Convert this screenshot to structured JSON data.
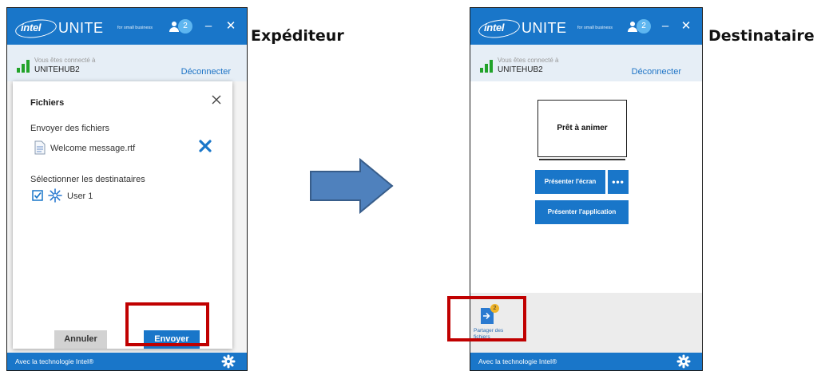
{
  "labels": {
    "sender": "Expéditeur",
    "recipient": "Destinataire"
  },
  "app": {
    "logo_intel": "intel",
    "logo_unite": "UNITE",
    "logo_sub": "for small business",
    "users_count": "2",
    "connected_label": "Vous êtes connecté à",
    "hub_name": "UNITEHUB2",
    "disconnect": "Déconnecter",
    "footer": "Avec la technologie Intel®",
    "brand_color": "#1976c9",
    "signal_color": "#22a32a"
  },
  "sender_dialog": {
    "title": "Fichiers",
    "send_files_label": "Envoyer des fichiers",
    "file_name": "Welcome message.rtf",
    "select_recipients_label": "Sélectionner les destinataires",
    "recipient_checked": true,
    "recipient_name": "User 1",
    "cancel": "Annuler",
    "send": "Envoyer"
  },
  "recipient_view": {
    "ready_status": "Prêt à animer",
    "present_screen": "Présenter l'écran",
    "more": "•••",
    "present_app": "Présenter l'application",
    "share_label": "Partager des fichiers",
    "share_badge": "2"
  },
  "icons": {
    "users": "users-icon",
    "minimize": "minimize-icon",
    "close": "close-icon",
    "signal": "signal-bars-icon",
    "gear": "gear-icon",
    "file": "document-icon",
    "remove": "remove-x-icon",
    "checkbox": "checkbox-checked-icon",
    "avatar": "snowflake-avatar-icon",
    "share": "share-files-icon",
    "arrow": "right-arrow-icon"
  },
  "highlight_color": "#c00000"
}
